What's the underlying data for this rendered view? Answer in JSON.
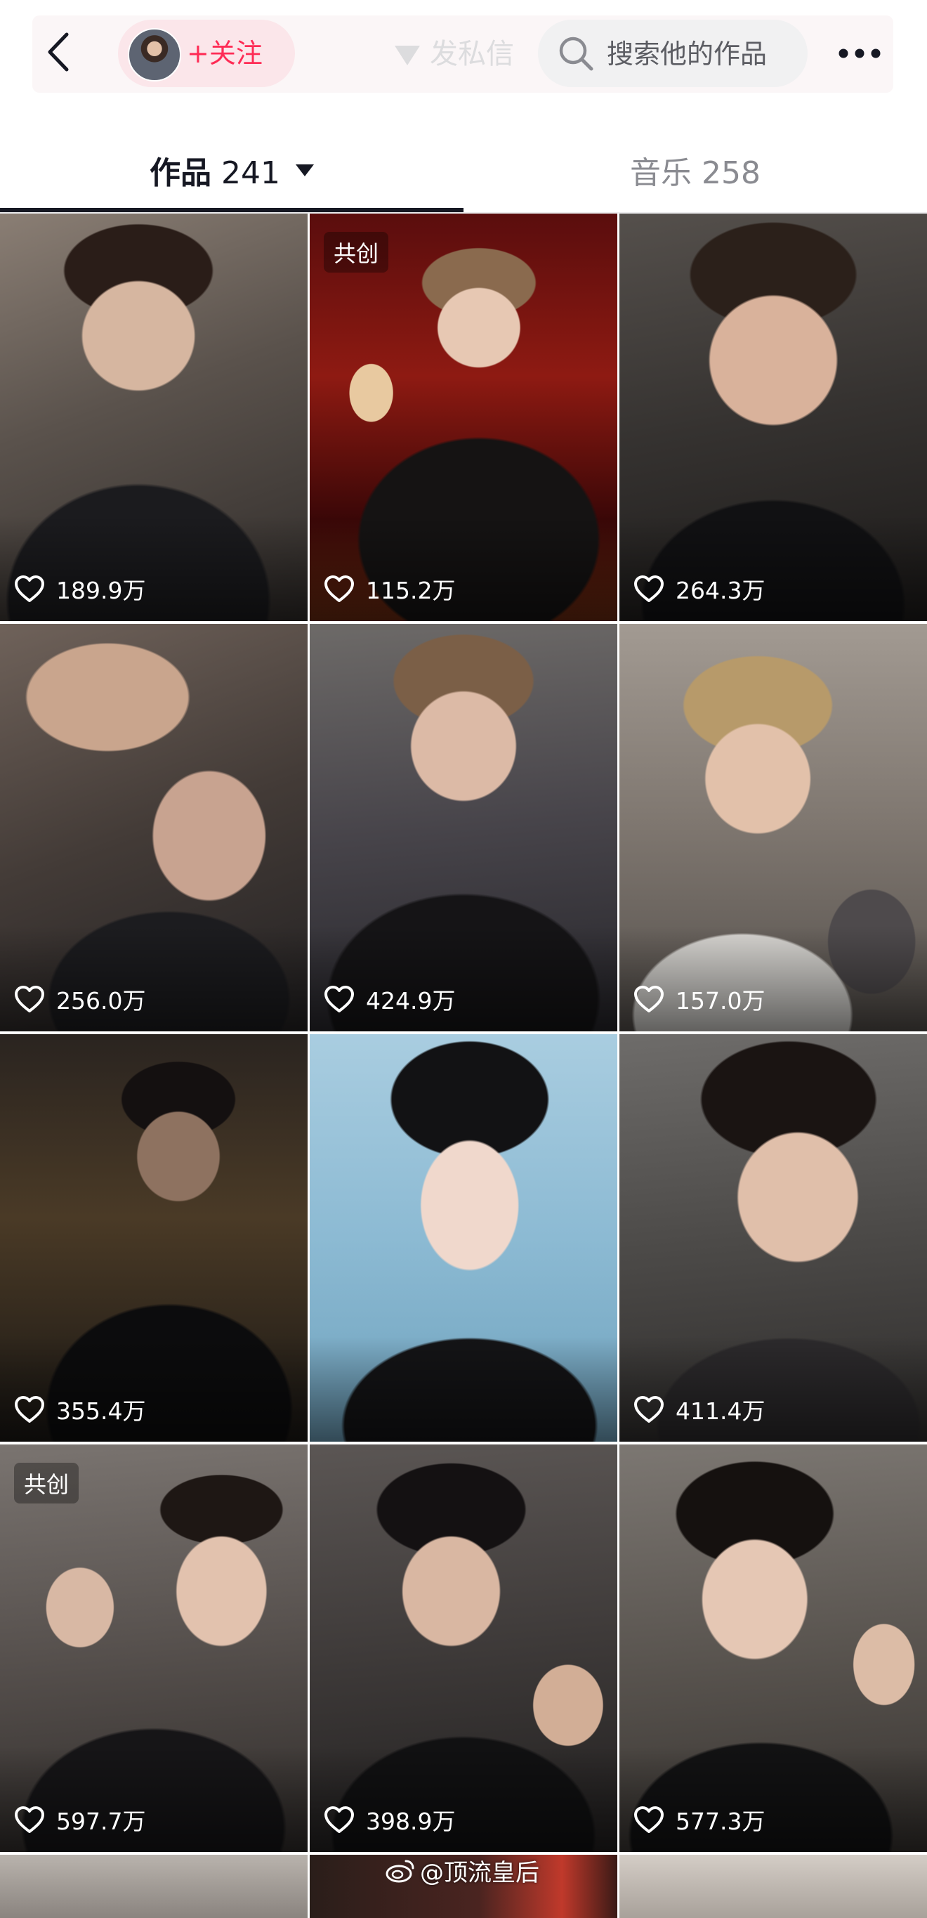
{
  "header": {
    "follow_label": "+关注",
    "message_label": "发私信",
    "search_placeholder": "搜索他的作品"
  },
  "tabs": [
    {
      "label": "作品",
      "count": "241",
      "active": true
    },
    {
      "label": "音乐",
      "count": "258",
      "active": false
    }
  ],
  "videos": [
    {
      "likes": "189.9万",
      "badge": ""
    },
    {
      "likes": "115.2万",
      "badge": "共创"
    },
    {
      "likes": "264.3万",
      "badge": ""
    },
    {
      "likes": "256.0万",
      "badge": ""
    },
    {
      "likes": "424.9万",
      "badge": ""
    },
    {
      "likes": "157.0万",
      "badge": ""
    },
    {
      "likes": "355.4万",
      "badge": ""
    },
    {
      "likes": "",
      "badge": ""
    },
    {
      "likes": "411.4万",
      "badge": ""
    },
    {
      "likes": "597.7万",
      "badge": "共创"
    },
    {
      "likes": "398.9万",
      "badge": ""
    },
    {
      "likes": "577.3万",
      "badge": ""
    }
  ],
  "watermark": "@顶流皇后",
  "colors": {
    "accent": "#fe2c55",
    "text_primary": "#161823",
    "text_secondary": "#8a8b91"
  },
  "icons": [
    "back-arrow-icon",
    "avatar",
    "search-icon",
    "more-icon",
    "heart-icon",
    "weibo-icon"
  ]
}
